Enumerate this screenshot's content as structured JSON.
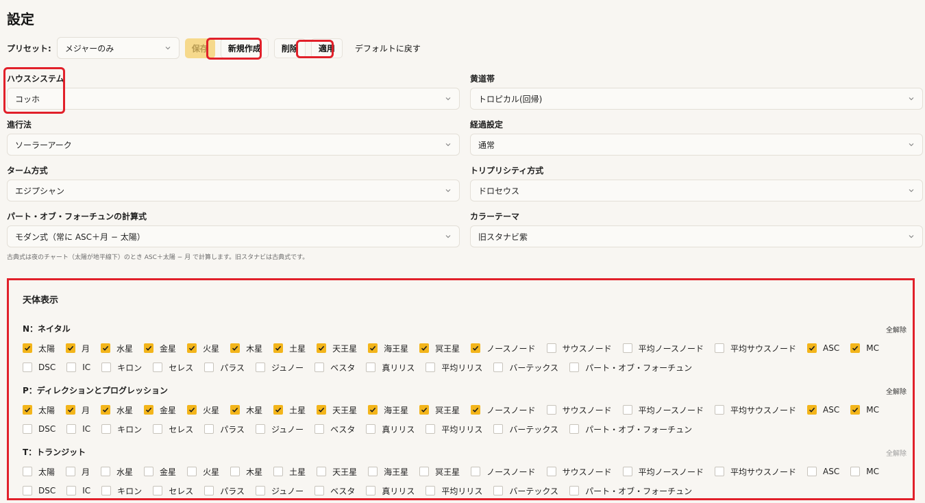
{
  "title": "設定",
  "preset": {
    "label": "プリセット:",
    "value": "メジャーのみ",
    "save": "保存",
    "new": "新規作成",
    "delete": "削除",
    "apply": "適用",
    "reset": "デフォルトに戻す"
  },
  "fields": [
    {
      "label": "ハウスシステム",
      "value": "コッホ"
    },
    {
      "label": "黄道帯",
      "value": "トロピカル(回帰)"
    },
    {
      "label": "進行法",
      "value": "ソーラーアーク"
    },
    {
      "label": "経過設定",
      "value": "通常"
    },
    {
      "label": "ターム方式",
      "value": "エジプシャン"
    },
    {
      "label": "トリプリシティ方式",
      "value": "ドロセウス"
    },
    {
      "label": "パート・オブ・フォーチュンの計算式",
      "value": "モダン式（常に ASC＋月 − 太陽）"
    },
    {
      "label": "カラーテーマ",
      "value": "旧スタナビ紫"
    }
  ],
  "note": "古典式は夜のチャート（太陽が地平線下）のとき ASC＋太陽 − 月 で計算します。旧スタナビは古典式です。",
  "bodies": {
    "title": "天体表示",
    "clear_all": "全解除",
    "items": [
      "太陽",
      "月",
      "水星",
      "金星",
      "火星",
      "木星",
      "土星",
      "天王星",
      "海王星",
      "冥王星",
      "ノースノード",
      "サウスノード",
      "平均ノースノード",
      "平均サウスノード",
      "ASC",
      "MC",
      "DSC",
      "IC",
      "キロン",
      "セレス",
      "パラス",
      "ジュノー",
      "ベスタ",
      "真リリス",
      "平均リリス",
      "バーテックス",
      "パート・オブ・フォーチュン"
    ],
    "groups": [
      {
        "title": "N：ネイタル",
        "checked": [
          true,
          true,
          true,
          true,
          true,
          true,
          true,
          true,
          true,
          true,
          true,
          false,
          false,
          false,
          true,
          true,
          false,
          false,
          false,
          false,
          false,
          false,
          false,
          false,
          false,
          false,
          false
        ]
      },
      {
        "title": "P：ディレクションとプログレッション",
        "checked": [
          true,
          true,
          true,
          true,
          true,
          true,
          true,
          true,
          true,
          true,
          true,
          false,
          false,
          false,
          true,
          true,
          false,
          false,
          false,
          false,
          false,
          false,
          false,
          false,
          false,
          false,
          false
        ]
      },
      {
        "title": "T：トランジット",
        "checked": [
          false,
          false,
          false,
          false,
          false,
          false,
          false,
          false,
          false,
          false,
          false,
          false,
          false,
          false,
          false,
          false,
          false,
          false,
          false,
          false,
          false,
          false,
          false,
          false,
          false,
          false,
          false
        ]
      }
    ]
  },
  "colors": {
    "accent": "#f3b51b",
    "highlight": "#e1202a"
  }
}
